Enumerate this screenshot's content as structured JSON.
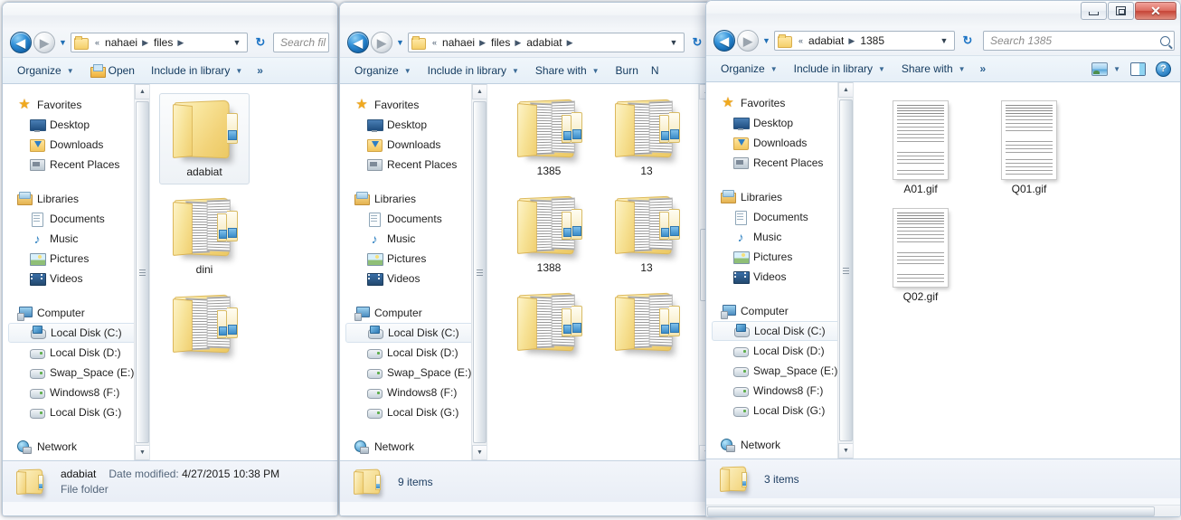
{
  "desktop": {
    "background_color": "#ffffff"
  },
  "common": {
    "nav_sections": [
      {
        "header": "Favorites",
        "icon": "star-icon",
        "items": [
          {
            "label": "Desktop",
            "icon": "desktop-icon"
          },
          {
            "label": "Downloads",
            "icon": "downloads-icon"
          },
          {
            "label": "Recent Places",
            "icon": "recent-places-icon"
          }
        ]
      },
      {
        "header": "Libraries",
        "icon": "libraries-icon",
        "items": [
          {
            "label": "Documents",
            "icon": "documents-icon"
          },
          {
            "label": "Music",
            "icon": "music-icon"
          },
          {
            "label": "Pictures",
            "icon": "pictures-icon"
          },
          {
            "label": "Videos",
            "icon": "videos-icon"
          }
        ]
      },
      {
        "header": "Computer",
        "icon": "computer-icon",
        "items": [
          {
            "label": "Local Disk (C:)",
            "icon": "system-drive-icon",
            "selected": true
          },
          {
            "label": "Local Disk (D:)",
            "icon": "drive-icon"
          },
          {
            "label": "Swap_Space (E:)",
            "icon": "drive-icon"
          },
          {
            "label": "Windows8 (F:)",
            "icon": "drive-icon"
          },
          {
            "label": "Local Disk (G:)",
            "icon": "drive-icon"
          }
        ]
      },
      {
        "header": "Network",
        "icon": "network-icon",
        "items": []
      }
    ],
    "back_arrow": "◀",
    "forward_arrow": "▶",
    "dropdown_caret": "▼",
    "refresh_glyph": "↻",
    "crumb_separator": "▶",
    "crumb_overflow": "«",
    "scroll_up": "▲",
    "scroll_down": "▼",
    "help_glyph": "?",
    "close_glyph": "✕",
    "toolbar_overflow": "»"
  },
  "windows": [
    {
      "id": "window-files",
      "title": "",
      "address": {
        "overflow": "«",
        "crumbs": [
          "nahaei",
          "files"
        ]
      },
      "search": {
        "placeholder": "Search fil"
      },
      "toolbar": [
        {
          "label": "Organize",
          "caret": true,
          "icon": null
        },
        {
          "label": "Open",
          "caret": false,
          "icon": "open-folder-icon"
        },
        {
          "label": "Include in library",
          "caret": true,
          "icon": null
        },
        {
          "label": "»",
          "caret": false,
          "icon": null
        }
      ],
      "items": [
        {
          "label": "adabiat",
          "type": "folder-empty",
          "selected": true
        },
        {
          "label": "dini",
          "type": "folder-full",
          "selected": false
        },
        {
          "label": "",
          "type": "folder-full",
          "selected": false
        }
      ],
      "status": {
        "name": "adabiat",
        "meta_label": "Date modified:",
        "meta_value": "4/27/2015 10:38 PM",
        "type_line": "File folder"
      }
    },
    {
      "id": "window-adabiat",
      "title": "",
      "address": {
        "overflow": "«",
        "crumbs": [
          "nahaei",
          "files",
          "adabiat"
        ]
      },
      "search": {
        "placeholder": ""
      },
      "toolbar": [
        {
          "label": "Organize",
          "caret": true,
          "icon": null
        },
        {
          "label": "Include in library",
          "caret": true,
          "icon": null
        },
        {
          "label": "Share with",
          "caret": true,
          "icon": null
        },
        {
          "label": "Burn",
          "caret": false,
          "icon": null
        },
        {
          "label": "N",
          "caret": false,
          "icon": null
        }
      ],
      "items": [
        {
          "label": "1385",
          "type": "folder-full",
          "selected": false
        },
        {
          "label": "13",
          "type": "folder-full",
          "selected": false
        },
        {
          "label": "1388",
          "type": "folder-full",
          "selected": false
        },
        {
          "label": "13",
          "type": "folder-full",
          "selected": false
        },
        {
          "label": "",
          "type": "folder-full",
          "selected": false
        },
        {
          "label": "",
          "type": "folder-full",
          "selected": false
        }
      ],
      "status": {
        "count": "9 items"
      }
    },
    {
      "id": "window-1385",
      "title": "",
      "address": {
        "overflow": "«",
        "crumbs": [
          "adabiat",
          "1385"
        ]
      },
      "search": {
        "placeholder": "Search 1385"
      },
      "toolbar": [
        {
          "label": "Organize",
          "caret": true,
          "icon": null
        },
        {
          "label": "Include in library",
          "caret": true,
          "icon": null
        },
        {
          "label": "Share with",
          "caret": true,
          "icon": null
        },
        {
          "label": "»",
          "caret": false,
          "icon": null
        }
      ],
      "toolbar_right": [
        {
          "name": "change-view-icon",
          "caret": true
        },
        {
          "name": "preview-pane-icon",
          "caret": false
        },
        {
          "name": "help-icon",
          "caret": false
        }
      ],
      "window_controls": {
        "minimize": "minimize-icon",
        "maximize": "restore-icon",
        "close": "close-icon"
      },
      "items": [
        {
          "label": "A01.gif",
          "type": "gif",
          "selected": false
        },
        {
          "label": "Q01.gif",
          "type": "gif",
          "selected": false
        },
        {
          "label": "Q02.gif",
          "type": "gif",
          "selected": false
        }
      ],
      "status": {
        "count": "3 items"
      }
    }
  ]
}
